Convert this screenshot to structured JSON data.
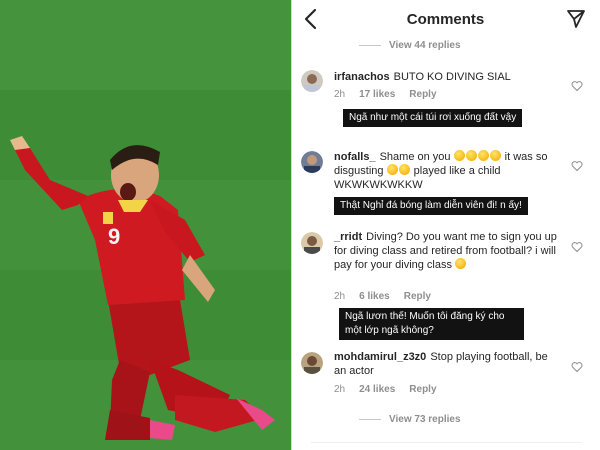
{
  "header": {
    "title": "Comments"
  },
  "view_more_top": "View 44 replies",
  "comments": [
    {
      "username": "irfanachos",
      "text": "BUTO KO DIVING SIAL",
      "time": "2h",
      "likes": "17 likes",
      "reply": "Reply",
      "translation": "Ngã như một cái túi rơi xuống đất vậy"
    },
    {
      "username": "nofalls_",
      "text_a": "Shame on you",
      "text_b": "it was so disgusting",
      "text_c": "played like a child WKWKWKWKKW",
      "translation": "Thật Nghỉ đá bóng làm diễn viên đi!  n ấy!"
    },
    {
      "username": "_rridt",
      "text": "Diving? Do you want me to sign you up for diving class and retired from football? i will pay for your diving class",
      "time": "2h",
      "likes": "6 likes",
      "reply": "Reply",
      "translation": "Ngã lươn thế! Muốn tôi đăng ký cho một lớp ngã không?"
    },
    {
      "username": "mohdamirul_z3z0",
      "text": "Stop playing football, be an actor",
      "time": "2h",
      "likes": "24 likes",
      "reply": "Reply"
    }
  ],
  "view_more_bottom": "View 73 replies",
  "photo": {
    "jersey_number": "9"
  },
  "colors": {
    "jersey": "#c8171e",
    "pitch": "#3d8a34",
    "translation_bg": "#121212"
  }
}
